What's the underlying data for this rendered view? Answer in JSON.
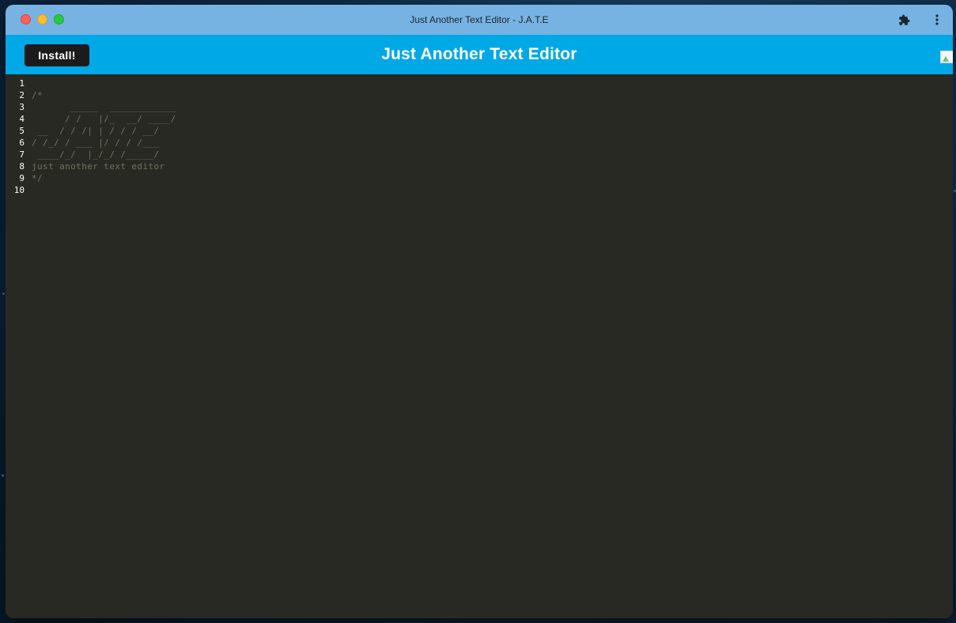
{
  "window": {
    "title": "Just Another Text Editor - J.A.T.E"
  },
  "header": {
    "install_label": "Install!",
    "title": "Just Another Text Editor"
  },
  "icons": {
    "extensions": "puzzle-icon",
    "menu": "more-vert-icon"
  },
  "colors": {
    "titlebar": "#76b3e2",
    "header": "#00a8e6",
    "editor_bg": "#282923",
    "comment": "#75715e"
  },
  "editor": {
    "lines": [
      {
        "num": "1",
        "text": ""
      },
      {
        "num": "2",
        "text": "/*"
      },
      {
        "num": "3",
        "text": "       _____  ____________"
      },
      {
        "num": "4",
        "text": "      / /   |/_  __/ ____/"
      },
      {
        "num": "5",
        "text": " __  / / /| | / / / __/"
      },
      {
        "num": "6",
        "text": "/ /_/ / ___ |/ / / /___"
      },
      {
        "num": "7",
        "text": " ____/_/  |_/_/ /_____/"
      },
      {
        "num": "8",
        "text": "just another text editor"
      },
      {
        "num": "9",
        "text": "*/"
      },
      {
        "num": "10",
        "text": ""
      }
    ]
  }
}
